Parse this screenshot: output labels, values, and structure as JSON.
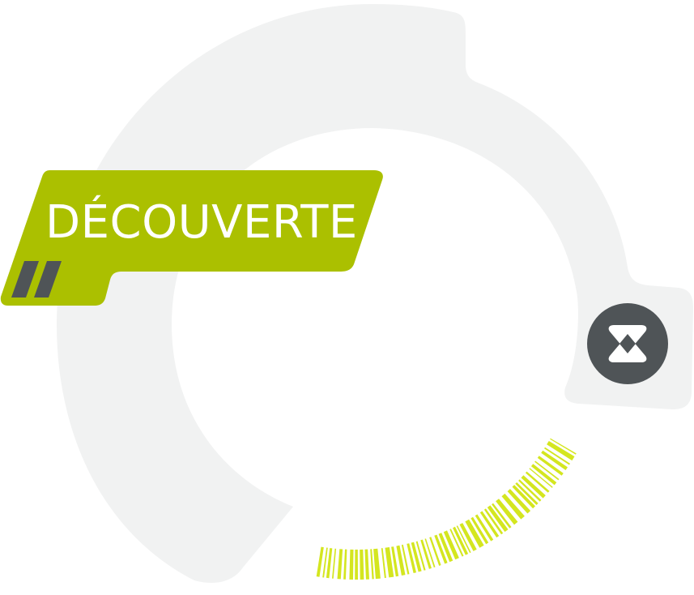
{
  "badge": {
    "label": "DÉCOUVERTE",
    "color": "#abc000",
    "stripe_color": "#4f5457"
  },
  "ring": {
    "color": "#f1f2f2"
  },
  "close_button": {
    "icon": "close-icon",
    "color": "#4f5457"
  },
  "progress": {
    "color": "#d4e61f"
  }
}
